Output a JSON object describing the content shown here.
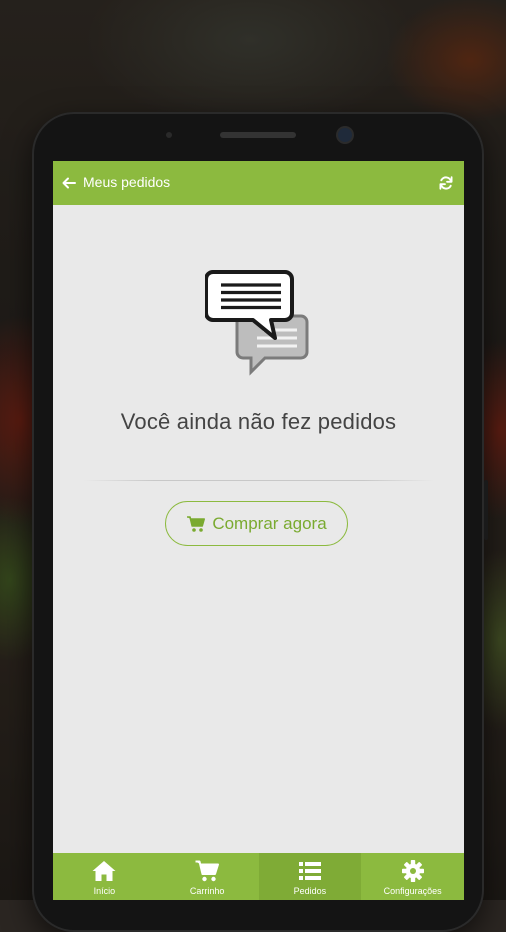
{
  "app_bar": {
    "title": "Meus pedidos",
    "back_icon": "arrow-left-icon",
    "refresh_icon": "refresh-icon"
  },
  "empty_state": {
    "illustration_icon": "chat-bubbles-icon",
    "message": "Você ainda não fez pedidos",
    "button_label": "Comprar agora",
    "button_icon": "shopping-cart-icon"
  },
  "bottom_nav": {
    "items": [
      {
        "label": "Início",
        "icon": "home-icon",
        "active": false
      },
      {
        "label": "Carrinho",
        "icon": "shopping-cart-icon",
        "active": false
      },
      {
        "label": "Pedidos",
        "icon": "list-icon",
        "active": true
      },
      {
        "label": "Configurações",
        "icon": "gear-icon",
        "active": false
      }
    ]
  },
  "colors": {
    "accent": "#8cba3f",
    "screen_background": "#e9e9e9",
    "text": "#444444"
  }
}
